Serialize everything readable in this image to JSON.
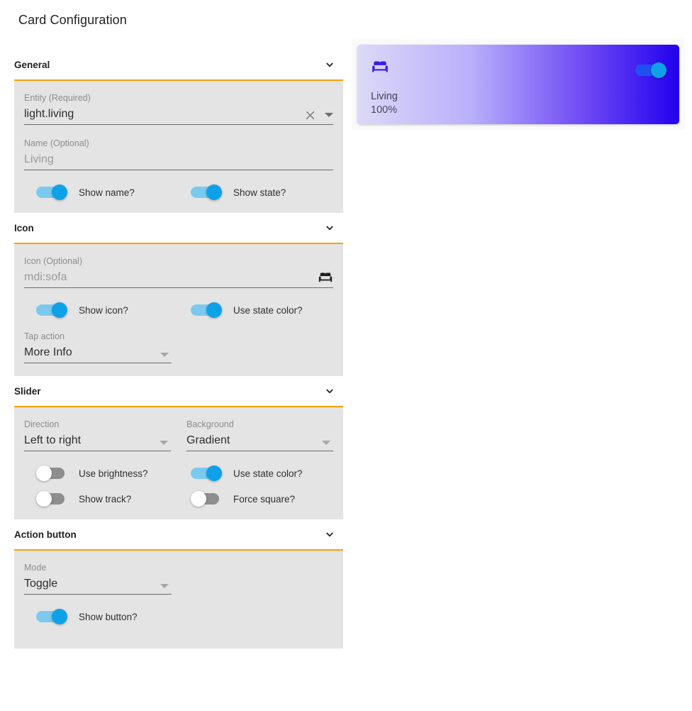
{
  "page": {
    "title": "Card Configuration"
  },
  "sections": {
    "general": {
      "title": "General",
      "collapse_icon": "chevron-down-icon",
      "entity": {
        "label": "Entity (Required)",
        "value": "light.living",
        "clear_icon": "close-icon",
        "dropdown_icon": "caret-down-icon"
      },
      "name": {
        "label": "Name (Optional)",
        "value": "Living"
      },
      "toggles": [
        {
          "label": "Show name?",
          "state": "on"
        },
        {
          "label": "Show state?",
          "state": "on"
        }
      ]
    },
    "icon": {
      "title": "Icon",
      "collapse_icon": "chevron-down-icon",
      "icon_field": {
        "label": "Icon (Optional)",
        "value": "mdi:sofa",
        "preview_icon": "sofa-icon"
      },
      "toggles": [
        {
          "label": "Show icon?",
          "state": "on"
        },
        {
          "label": "Use state color?",
          "state": "on"
        }
      ],
      "tap_action": {
        "label": "Tap action",
        "value": "More Info",
        "dropdown_icon": "caret-down-icon"
      }
    },
    "slider": {
      "title": "Slider",
      "collapse_icon": "chevron-down-icon",
      "direction": {
        "label": "Direction",
        "value": "Left to right",
        "dropdown_icon": "caret-down-icon"
      },
      "background": {
        "label": "Background",
        "value": "Gradient",
        "dropdown_icon": "caret-down-icon"
      },
      "toggles": [
        {
          "label": "Use brightness?",
          "state": "off"
        },
        {
          "label": "Use state color?",
          "state": "on"
        },
        {
          "label": "Show track?",
          "state": "off"
        },
        {
          "label": "Force square?",
          "state": "off"
        }
      ]
    },
    "action_button": {
      "title": "Action button",
      "collapse_icon": "chevron-down-icon",
      "mode": {
        "label": "Mode",
        "value": "Toggle",
        "dropdown_icon": "caret-down-icon"
      },
      "toggles": [
        {
          "label": "Show button?",
          "state": "on"
        }
      ]
    }
  },
  "preview": {
    "icon": "sofa-icon",
    "name": "Living",
    "state": "100%",
    "toggle_state": "on",
    "colors": {
      "gradient_start": "#dcd8f8",
      "gradient_end": "#2200ee",
      "icon_color": "#3b19e6",
      "toggle_knob": "#0fa1e8"
    }
  },
  "theme": {
    "accent_divider": "#f5a208",
    "panel_background": "#e4e4e4",
    "toggle_on_track": "#7cc9f0",
    "toggle_on_knob": "#0fa1e8",
    "toggle_off_track": "#8e8e8e"
  }
}
